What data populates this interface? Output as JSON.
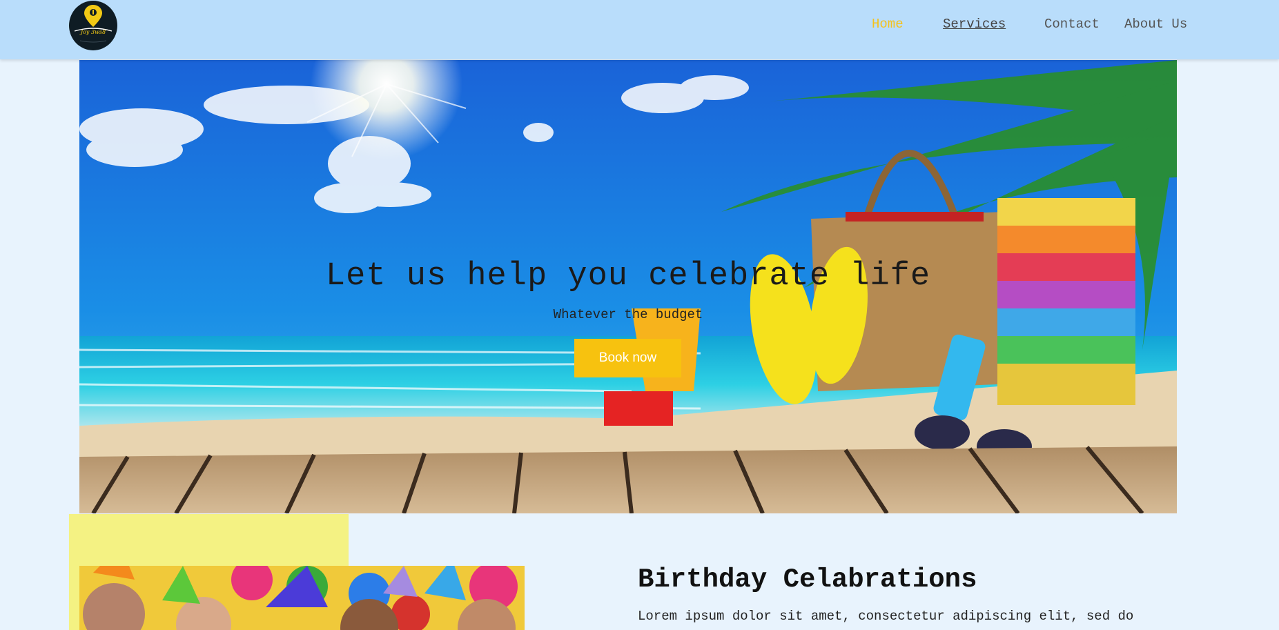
{
  "header": {
    "logo": {
      "icon": "map-pin-icon",
      "text": "Joy 3ws8"
    },
    "nav": {
      "home": "Home",
      "services": "Services",
      "contact": "Contact",
      "about": "About Us"
    }
  },
  "hero": {
    "title": "Let us help you celebrate life",
    "subtitle": "Whatever the budget",
    "cta": "Book now",
    "image": "beach-scene"
  },
  "birthday": {
    "title": "Birthday Celabrations",
    "text": "Lorem ipsum dolor sit amet, consectetur adipiscing elit, sed do",
    "image": "kids-party-photo"
  },
  "colors": {
    "header_bg": "#b9ddfb",
    "page_bg": "#e8f3fd",
    "accent": "#f7c20f",
    "yellow_block": "#f4f283"
  }
}
